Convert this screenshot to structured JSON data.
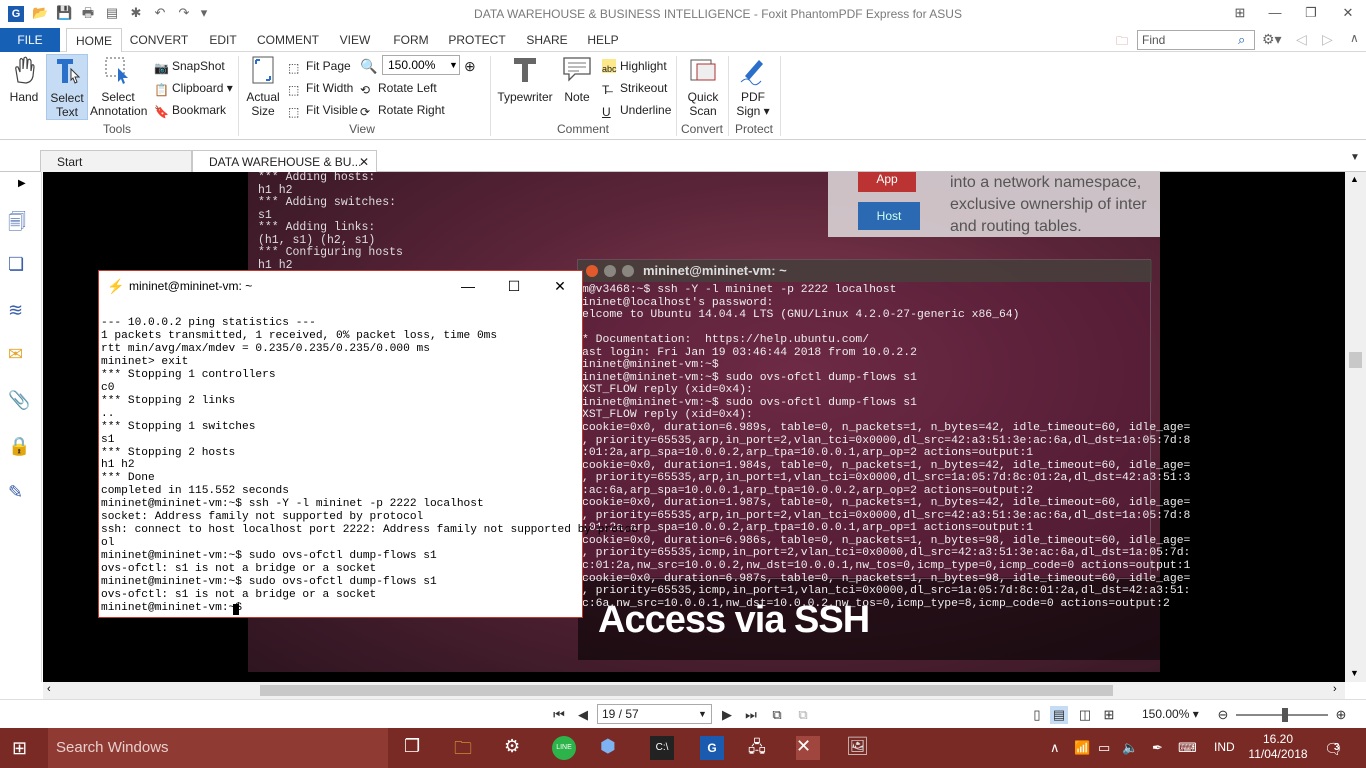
{
  "window": {
    "title": "DATA WAREHOUSE & BUSINESS INTELLIGENCE - Foxit PhantomPDF Express for ASUS"
  },
  "menu": {
    "tabs": [
      "FILE",
      "HOME",
      "CONVERT",
      "EDIT",
      "COMMENT",
      "VIEW",
      "FORM",
      "PROTECT",
      "SHARE",
      "HELP"
    ],
    "search_placeholder": "Find"
  },
  "ribbon": {
    "hand": "Hand",
    "select_text": [
      "Select",
      "Text"
    ],
    "select_annotation": [
      "Select",
      "Annotation"
    ],
    "snapshot": "SnapShot",
    "clipboard": "Clipboard",
    "bookmark": "Bookmark",
    "tools_label": "Tools",
    "actual_size": [
      "Actual",
      "Size"
    ],
    "fit_page": "Fit Page",
    "fit_width": "Fit Width",
    "fit_visible": "Fit Visible",
    "zoom_value": "150.00%",
    "rotate_left": "Rotate Left",
    "rotate_right": "Rotate Right",
    "view_label": "View",
    "typewriter": "Typewriter",
    "note": "Note",
    "highlight": "Highlight",
    "strikeout": "Strikeout",
    "underline": "Underline",
    "comment_label": "Comment",
    "quick_scan": [
      "Quick",
      "Scan"
    ],
    "convert_label": "Convert",
    "pdf_sign": [
      "PDF",
      "Sign ▾"
    ],
    "protect_label": "Protect"
  },
  "doc_tabs": {
    "start": "Start",
    "current": "DATA WAREHOUSE & BU..."
  },
  "slide": {
    "right_text": "into a network namespace, exclusive ownership of inter and routing tables.",
    "bg_terminal": "*** Adding hosts:\nh1 h2\n*** Adding switches:\ns1\n*** Adding links:\n(h1, s1) (h2, s1)\n*** Configuring hosts\nh1 h2",
    "caption": "Access via SSH",
    "app_label": "App",
    "host_label": "Host"
  },
  "ubuntu_terminal": {
    "title": "mininet@mininet-vm: ~",
    "lines": "m@v3468:~$ ssh -Y -l mininet -p 2222 localhost\nininet@localhost's password:\nelcome to Ubuntu 14.04.4 LTS (GNU/Linux 4.2.0-27-generic x86_64)\n\n* Documentation:  https://help.ubuntu.com/\nast login: Fri Jan 19 03:46:44 2018 from 10.0.2.2\nininet@mininet-vm:~$\nininet@mininet-vm:~$ sudo ovs-ofctl dump-flows s1\nXST_FLOW reply (xid=0x4):\nininet@mininet-vm:~$ sudo ovs-ofctl dump-flows s1\nXST_FLOW reply (xid=0x4):\ncookie=0x0, duration=6.989s, table=0, n_packets=1, n_bytes=42, idle_timeout=60, idle_age=\n, priority=65535,arp,in_port=2,vlan_tci=0x0000,dl_src=42:a3:51:3e:ac:6a,dl_dst=1a:05:7d:8\n:01:2a,arp_spa=10.0.0.2,arp_tpa=10.0.0.1,arp_op=2 actions=output:1\ncookie=0x0, duration=1.984s, table=0, n_packets=1, n_bytes=42, idle_timeout=60, idle_age=\n, priority=65535,arp,in_port=1,vlan_tci=0x0000,dl_src=1a:05:7d:8c:01:2a,dl_dst=42:a3:51:3\n:ac:6a,arp_spa=10.0.0.1,arp_tpa=10.0.0.2,arp_op=2 actions=output:2\ncookie=0x0, duration=1.987s, table=0, n_packets=1, n_bytes=42, idle_timeout=60, idle_age=\n, priority=65535,arp,in_port=2,vlan_tci=0x0000,dl_src=42:a3:51:3e:ac:6a,dl_dst=1a:05:7d:8\n:01:2a,arp_spa=10.0.0.2,arp_tpa=10.0.0.1,arp_op=1 actions=output:1\ncookie=0x0, duration=6.986s, table=0, n_packets=1, n_bytes=98, idle_timeout=60, idle_age=\n, priority=65535,icmp,in_port=2,vlan_tci=0x0000,dl_src=42:a3:51:3e:ac:6a,dl_dst=1a:05:7d:\nc:01:2a,nw_src=10.0.0.2,nw_dst=10.0.0.1,nw_tos=0,icmp_type=0,icmp_code=0 actions=output:1\ncookie=0x0, duration=6.987s, table=0, n_packets=1, n_bytes=98, idle_timeout=60, idle_age=\n, priority=65535,icmp,in_port=1,vlan_tci=0x0000,dl_src=1a:05:7d:8c:01:2a,dl_dst=42:a3:51:\nc:6a,nw_src=10.0.0.1,nw_dst=10.0.0.2,nw_tos=0,icmp_type=8,icmp_code=0 actions=output:2"
  },
  "putty": {
    "title": "mininet@mininet-vm: ~",
    "lines": "--- 10.0.0.2 ping statistics ---\n1 packets transmitted, 1 received, 0% packet loss, time 0ms\nrtt min/avg/max/mdev = 0.235/0.235/0.235/0.000 ms\nmininet> exit\n*** Stopping 1 controllers\nc0\n*** Stopping 2 links\n..\n*** Stopping 1 switches\ns1\n*** Stopping 2 hosts\nh1 h2\n*** Done\ncompleted in 115.552 seconds\nmininet@mininet-vm:~$ ssh -Y -l mininet -p 2222 localhost\nsocket: Address family not supported by protocol\nssh: connect to host localhost port 2222: Address family not supported by protoc\nol\nmininet@mininet-vm:~$ sudo ovs-ofctl dump-flows s1\novs-ofctl: s1 is not a bridge or a socket\nmininet@mininet-vm:~$ sudo ovs-ofctl dump-flows s1\novs-ofctl: s1 is not a bridge or a socket\nmininet@mininet-vm:~$ "
  },
  "status": {
    "page": "19 / 57",
    "zoom": "150.00%"
  },
  "taskbar": {
    "search": "Search Windows",
    "lang": "IND",
    "time": "16.20",
    "date": "11/04/2018",
    "notifications": "3"
  }
}
